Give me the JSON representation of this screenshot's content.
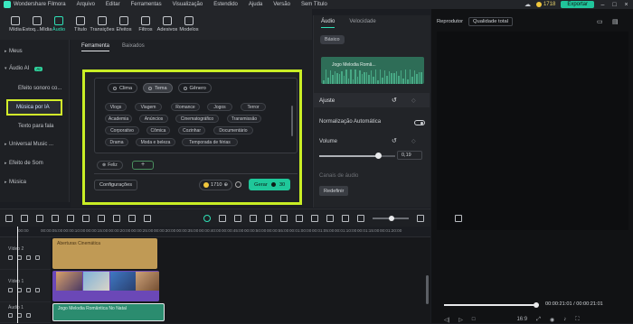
{
  "menubar": {
    "app_title": "Wondershare Filmora",
    "menus": [
      "Arquivo",
      "Editar",
      "Ferramentas",
      "Visualização",
      "Estendido",
      "Ajuda",
      "Versão",
      "Sem Título"
    ],
    "credits": "1718",
    "export_label": "Exportar"
  },
  "toolbar": {
    "items": [
      {
        "label": "Mídia",
        "icon": "media-icon"
      },
      {
        "label": "Estoq...Mídia",
        "icon": "stock-media-icon"
      },
      {
        "label": "Áudio",
        "icon": "audio-icon",
        "active": true
      },
      {
        "label": "Título",
        "icon": "title-icon"
      },
      {
        "label": "Transições",
        "icon": "transitions-icon"
      },
      {
        "label": "Efeitos",
        "icon": "effects-icon"
      },
      {
        "label": "Filtros",
        "icon": "filters-icon"
      },
      {
        "label": "Adesivos",
        "icon": "stickers-icon"
      },
      {
        "label": "Modelos",
        "icon": "templates-icon"
      }
    ]
  },
  "sidebar": {
    "meus": "Meus",
    "audio_ai": "Áudio AI",
    "ai_badge": "AI",
    "efeito_sonoro": "Efeito sonoro co...",
    "musica_ia": "Música por IA",
    "texto_fala": "Texto para fala",
    "universal": "Universal Music ...",
    "efeito_som": "Efeito de Som",
    "musica": "Música"
  },
  "content": {
    "tab_ferramenta": "Ferramenta",
    "tab_baixados": "Baixados"
  },
  "aipanel": {
    "seg_clima": "Clima",
    "seg_tema": "Tema",
    "seg_genero": "Gênero",
    "chips": [
      "Vlogs",
      "Viagem",
      "Romance",
      "Jogos",
      "Terror",
      "Academia",
      "Anúncios",
      "Cinematográfico",
      "Transmissão",
      "Corporativo",
      "Cômica",
      "Cozinhar",
      "Documentário",
      "Drama",
      "Moda e beleza",
      "Temporada de férias"
    ],
    "feliz": "Feliz",
    "plus": "+",
    "config": "Configurações",
    "credits": "1710",
    "gerar": "Gerar",
    "gerar_cost": "30"
  },
  "right": {
    "tab_audio": "Áudio",
    "tab_velocidade": "Velocidade",
    "basico": "Básico",
    "clip_title": "Jogo Melodia Româ...",
    "ajuste": "Ajuste",
    "normalizacao": "Normalização Automática",
    "volume": "Volume",
    "volume_value": "0,19",
    "canais": "Canais de áudio",
    "redefinir": "Redefinir"
  },
  "preview": {
    "reprodutor": "Reprodutor",
    "qualidade": "Qualidade total",
    "timecode": "00:00:21:01",
    "duration": "00:00:21:01",
    "zoom_ratio": "16:9",
    "progress": 1.0
  },
  "ruler": [
    "00:00",
    "00:00:05:00",
    "00:00:10:00",
    "00:00:15:00",
    "00:00:20:00",
    "00:00:25:00",
    "00:00:30:00",
    "00:00:35:00",
    "00:00:40:00",
    "00:00:45:00",
    "00:00:50:00",
    "00:00:55:00",
    "00:01:00:00",
    "00:01:05:00",
    "00:01:10:00",
    "00:01:15:00",
    "00:01:20:00"
  ],
  "tracks": {
    "video2": "Vídeo 2",
    "video1": "Vídeo 1",
    "audio1": "Áudio 1",
    "clip_orange": "Aberturas Cinemática",
    "clip_audio": "Jogo Melodia Romântica No Natal"
  },
  "colors": {
    "accent": "#2fe0b6",
    "highlight": "#d3ee2a",
    "export": "#20c59b",
    "video_clip": "#6b48b7",
    "title_clip": "#c09a55",
    "audio_clip": "#2b8c6f"
  }
}
